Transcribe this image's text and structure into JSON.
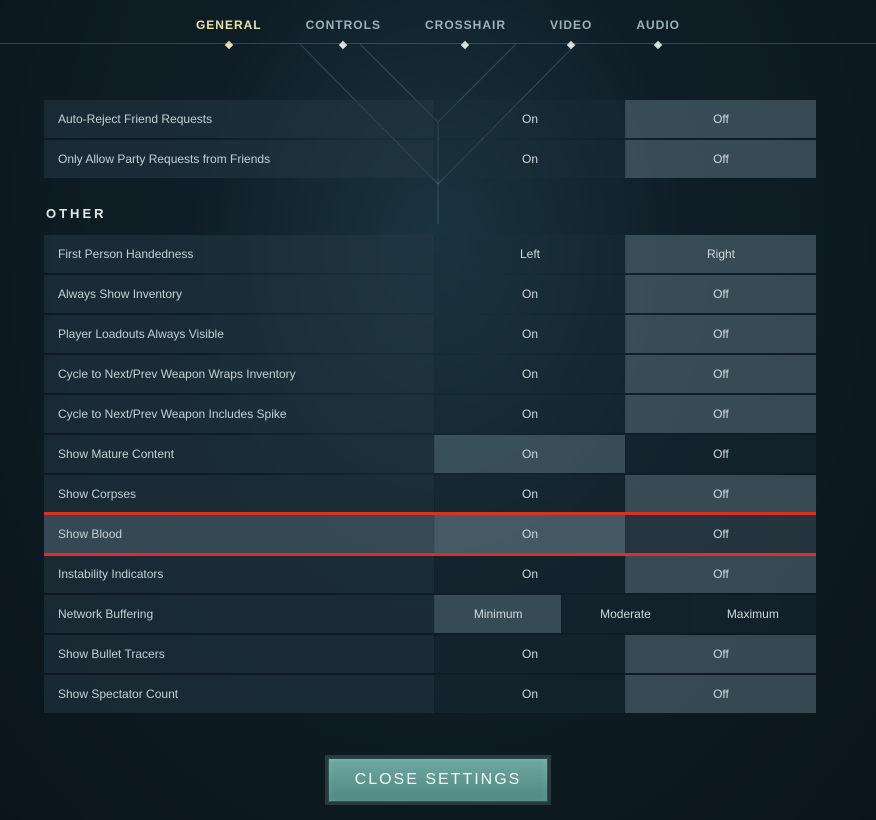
{
  "tabs": [
    {
      "label": "GENERAL",
      "active": true
    },
    {
      "label": "CONTROLS",
      "active": false
    },
    {
      "label": "CROSSHAIR",
      "active": false
    },
    {
      "label": "VIDEO",
      "active": false
    },
    {
      "label": "AUDIO",
      "active": false
    }
  ],
  "sections": [
    {
      "title": null,
      "rows": [
        {
          "label": "Auto-Reject Friend Requests",
          "options": [
            "On",
            "Off"
          ],
          "selected": 1
        },
        {
          "label": "Only Allow Party Requests from Friends",
          "options": [
            "On",
            "Off"
          ],
          "selected": 1
        }
      ]
    },
    {
      "title": "OTHER",
      "rows": [
        {
          "label": "First Person Handedness",
          "options": [
            "Left",
            "Right"
          ],
          "selected": 1
        },
        {
          "label": "Always Show Inventory",
          "options": [
            "On",
            "Off"
          ],
          "selected": 1
        },
        {
          "label": "Player Loadouts Always Visible",
          "options": [
            "On",
            "Off"
          ],
          "selected": 1
        },
        {
          "label": "Cycle to Next/Prev Weapon Wraps Inventory",
          "options": [
            "On",
            "Off"
          ],
          "selected": 1
        },
        {
          "label": "Cycle to Next/Prev Weapon Includes Spike",
          "options": [
            "On",
            "Off"
          ],
          "selected": 1
        },
        {
          "label": "Show Mature Content",
          "options": [
            "On",
            "Off"
          ],
          "selected": 0
        },
        {
          "label": "Show Corpses",
          "options": [
            "On",
            "Off"
          ],
          "selected": 1
        },
        {
          "label": "Show Blood",
          "options": [
            "On",
            "Off"
          ],
          "selected": 0,
          "highlight": true
        },
        {
          "label": "Instability Indicators",
          "options": [
            "On",
            "Off"
          ],
          "selected": 1
        },
        {
          "label": "Network Buffering",
          "options": [
            "Minimum",
            "Moderate",
            "Maximum"
          ],
          "selected": 0
        },
        {
          "label": "Show Bullet Tracers",
          "options": [
            "On",
            "Off"
          ],
          "selected": 1
        },
        {
          "label": "Show Spectator Count",
          "options": [
            "On",
            "Off"
          ],
          "selected": 1
        }
      ]
    }
  ],
  "close_label": "CLOSE SETTINGS"
}
